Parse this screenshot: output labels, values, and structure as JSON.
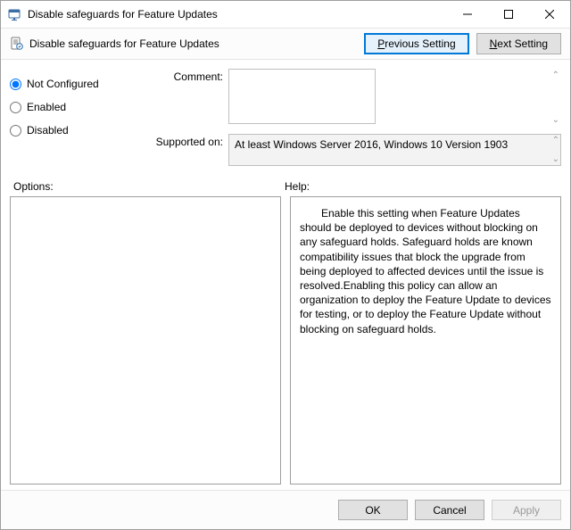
{
  "window": {
    "title": "Disable safeguards for Feature Updates"
  },
  "subheader": {
    "title": "Disable safeguards for Feature Updates"
  },
  "nav": {
    "previous_pre": "",
    "previous_u": "P",
    "previous_post": "revious Setting",
    "next_pre": "",
    "next_u": "N",
    "next_post": "ext Setting"
  },
  "state": {
    "not_configured": "Not Configured",
    "enabled": "Enabled",
    "disabled": "Disabled",
    "selected": "not_configured"
  },
  "fields": {
    "comment_label": "Comment:",
    "comment_value": "",
    "supported_label": "Supported on:",
    "supported_value": "At least Windows Server 2016, Windows 10 Version 1903"
  },
  "lower": {
    "options_label": "Options:",
    "help_label": "Help:",
    "help_text": "Enable this setting when Feature Updates should be deployed to devices without blocking on any safeguard holds. Safeguard holds are known compatibility issues that block the upgrade from being deployed to affected devices until the issue is resolved.Enabling this policy can allow an organization to deploy the Feature Update to devices for testing, or to deploy the Feature Update without blocking on safeguard holds."
  },
  "footer": {
    "ok": "OK",
    "cancel": "Cancel",
    "apply": "Apply"
  }
}
